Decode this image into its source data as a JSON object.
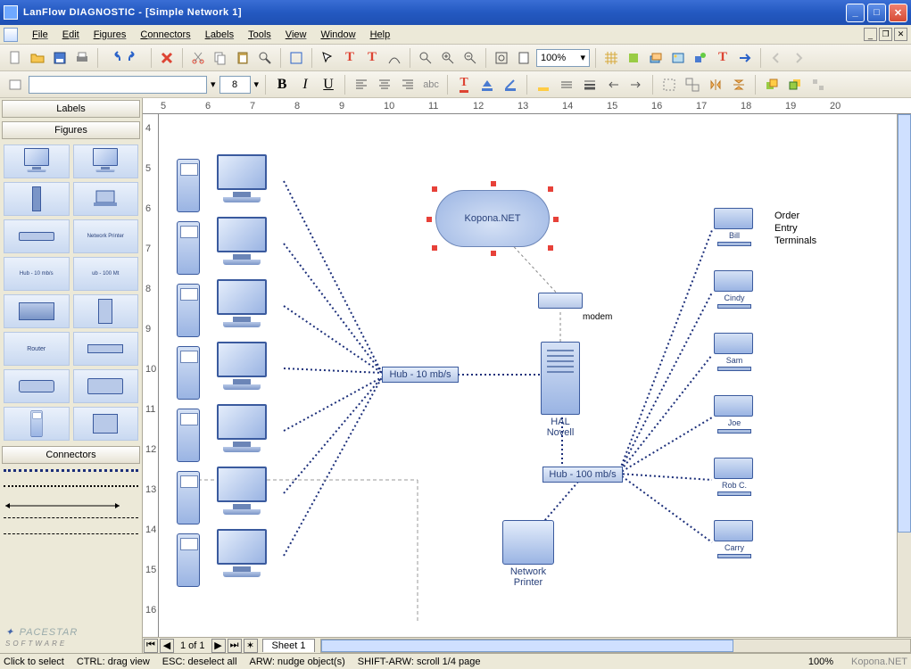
{
  "app_title": "LanFlow DIAGNOSTIC - [Simple Network 1]",
  "menu": [
    "File",
    "Edit",
    "Figures",
    "Connectors",
    "Labels",
    "Tools",
    "View",
    "Window",
    "Help"
  ],
  "toolbar1": {
    "zoom": "100%"
  },
  "toolbar2": {
    "font": "",
    "size": "8",
    "abc": "abc"
  },
  "sidebar": {
    "labels_hdr": "Labels",
    "figures_hdr": "Figures",
    "connectors_hdr": "Connectors",
    "figures": [
      {
        "name": "computer"
      },
      {
        "name": "server"
      },
      {
        "name": "tower"
      },
      {
        "name": "laptop"
      },
      {
        "name": "modem"
      },
      {
        "name": "network-printer",
        "label": "Network Printer"
      },
      {
        "name": "hub-10",
        "label": "Hub - 10 mb/s"
      },
      {
        "name": "hub-100",
        "label": "ub - 100 Mt"
      },
      {
        "name": "rack"
      },
      {
        "name": "mainframe"
      },
      {
        "name": "router",
        "label": "Router"
      },
      {
        "name": "switch"
      },
      {
        "name": "disk"
      },
      {
        "name": "drive"
      },
      {
        "name": "phone"
      },
      {
        "name": "fax"
      }
    ],
    "logo": "Pacestar",
    "logo_sub": "SOFTWARE"
  },
  "ruler_h": [
    "5",
    "6",
    "7",
    "8",
    "9",
    "10",
    "11",
    "12",
    "13",
    "14",
    "15",
    "16",
    "17",
    "18",
    "19",
    "20"
  ],
  "ruler_v": [
    "4",
    "5",
    "6",
    "7",
    "8",
    "9",
    "10",
    "11",
    "12",
    "13",
    "14",
    "15",
    "16"
  ],
  "diagram": {
    "cloud_label": "Kopona.NET",
    "modem_label": "modem",
    "tower_label1": "HAL",
    "tower_label2": "Novell",
    "hub1_label": "Hub - 10 mb/s",
    "hub2_label": "Hub - 100 mb/s",
    "printer_label1": "Network",
    "printer_label2": "Printer",
    "terminals_header1": "Order",
    "terminals_header2": "Entry",
    "terminals_header3": "Terminals",
    "terminals": [
      "Bill",
      "Cindy",
      "Sam",
      "Joe",
      "Rob C.",
      "Carry"
    ]
  },
  "sheet": {
    "page_of": "1 of 1",
    "tab": "Sheet 1"
  },
  "status": {
    "click": "Click to select",
    "ctrl": "CTRL: drag view",
    "esc": "ESC: deselect all",
    "arw": "ARW: nudge object(s)",
    "shift": "SHIFT-ARW: scroll 1/4 page",
    "zoom": "100%",
    "watermark": "Kopona.NET"
  }
}
